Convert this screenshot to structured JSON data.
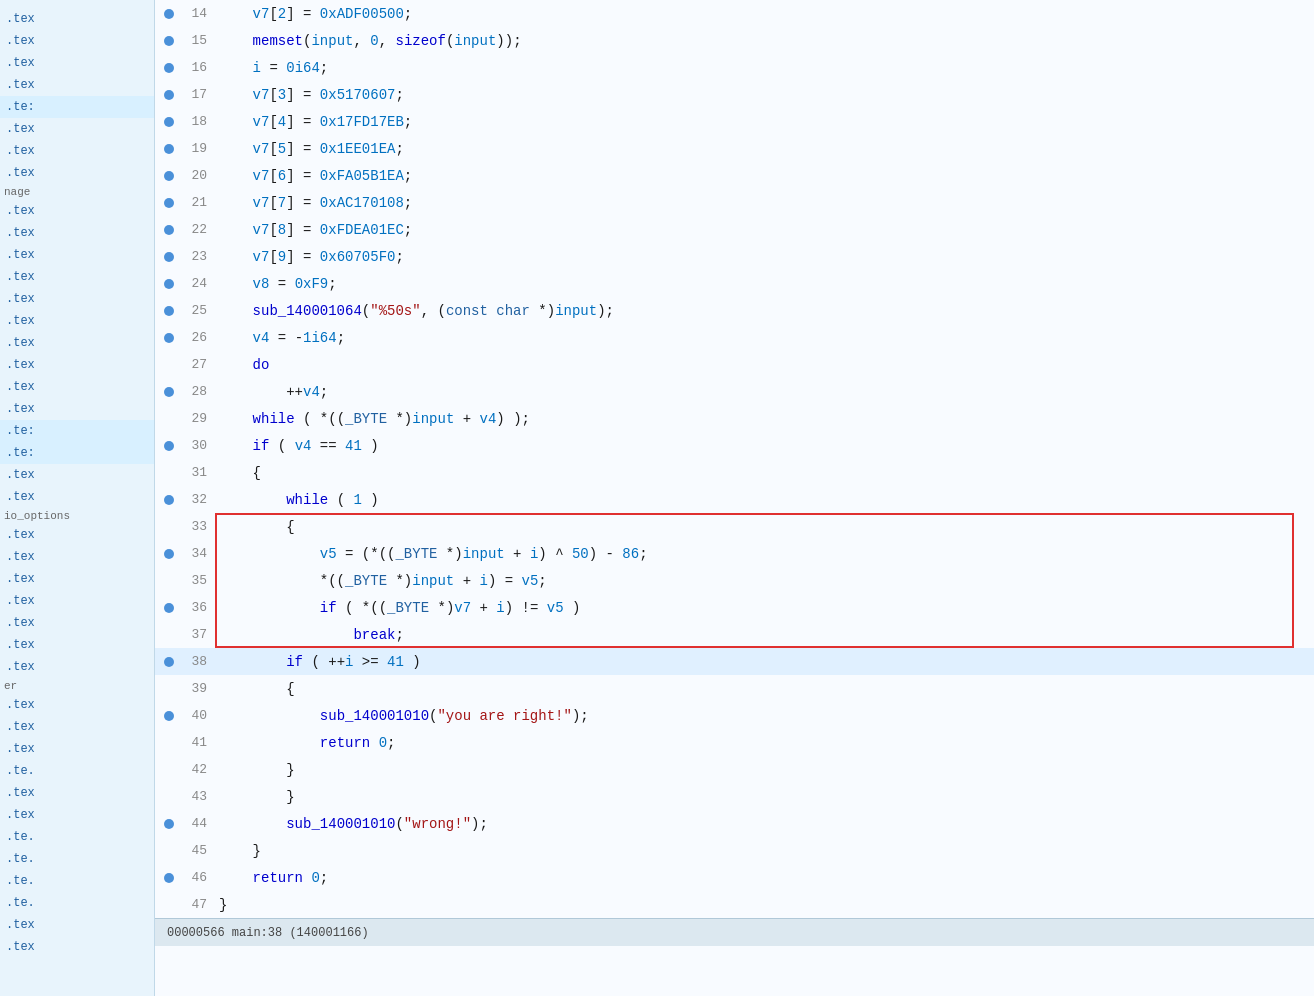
{
  "sidebar": {
    "items": [
      {
        "label": ".tex",
        "type": "normal"
      },
      {
        "label": ".tex",
        "type": "normal"
      },
      {
        "label": ".tex",
        "type": "normal"
      },
      {
        "label": ".tex",
        "type": "normal"
      },
      {
        "label": ".te:",
        "type": "light-blue"
      },
      {
        "label": ".tex",
        "type": "normal"
      },
      {
        "label": ".tex",
        "type": "normal"
      },
      {
        "label": ".tex",
        "type": "normal"
      },
      {
        "label": ".tex",
        "type": "normal"
      },
      {
        "label": ".tex",
        "type": "normal"
      },
      {
        "label": ".tex",
        "type": "normal"
      },
      {
        "label": ".tex",
        "type": "normal"
      },
      {
        "label": ".tex",
        "type": "normal"
      },
      {
        "label": ".te:",
        "type": "light-blue"
      },
      {
        "label": ".te:",
        "type": "light-blue"
      },
      {
        "label": ".tex",
        "type": "normal"
      },
      {
        "label": ".tex",
        "type": "normal"
      },
      {
        "label": ".tex",
        "type": "normal"
      },
      {
        "label": ".tex",
        "type": "normal"
      },
      {
        "label": ".tex",
        "type": "normal"
      },
      {
        "label": ".tex",
        "type": "normal"
      },
      {
        "label": ".tex",
        "type": "normal"
      },
      {
        "label": ".tex",
        "type": "normal"
      },
      {
        "label": ".tex",
        "type": "normal"
      },
      {
        "label": ".tex",
        "type": "normal"
      },
      {
        "label": ".te.",
        "type": "normal"
      },
      {
        "label": ".tex",
        "type": "normal"
      },
      {
        "label": ".tex",
        "type": "normal"
      },
      {
        "label": ".te.",
        "type": "normal"
      },
      {
        "label": ".te.",
        "type": "normal"
      },
      {
        "label": ".te.",
        "type": "normal"
      },
      {
        "label": ".te.",
        "type": "normal"
      },
      {
        "label": ".tex",
        "type": "normal"
      },
      {
        "label": ".tex",
        "type": "normal"
      }
    ],
    "labels": [
      {
        "label": "nage",
        "pos": 8
      },
      {
        "label": "io_options",
        "pos": 21
      },
      {
        "label": "er",
        "pos": 28
      }
    ]
  },
  "code": {
    "lines": [
      {
        "num": 14,
        "dot": true,
        "content": "v7[2] = 0xADF00500;",
        "indent": 2
      },
      {
        "num": 15,
        "dot": true,
        "content": "memset(input, 0, sizeof(input));",
        "indent": 2
      },
      {
        "num": 16,
        "dot": true,
        "content": "i = 0i64;",
        "indent": 2
      },
      {
        "num": 17,
        "dot": true,
        "content": "v7[3] = 0x5170607;",
        "indent": 2
      },
      {
        "num": 18,
        "dot": true,
        "content": "v7[4] = 0x17FD17EB;",
        "indent": 2
      },
      {
        "num": 19,
        "dot": true,
        "content": "v7[5] = 0x1EE01EA;",
        "indent": 2
      },
      {
        "num": 20,
        "dot": true,
        "content": "v7[6] = 0xFA05B1EA;",
        "indent": 2
      },
      {
        "num": 21,
        "dot": true,
        "content": "v7[7] = 0xAC170108;",
        "indent": 2
      },
      {
        "num": 22,
        "dot": true,
        "content": "v7[8] = 0xFDEA01EC;",
        "indent": 2
      },
      {
        "num": 23,
        "dot": true,
        "content": "v7[9] = 0x60705F0;",
        "indent": 2
      },
      {
        "num": 24,
        "dot": true,
        "content": "v8 = 0xF9;",
        "indent": 2
      },
      {
        "num": 25,
        "dot": true,
        "content": "sub_140001064(\"%50s\", (const char *)input);",
        "indent": 2
      },
      {
        "num": 26,
        "dot": true,
        "content": "v4 = -1i64;",
        "indent": 2
      },
      {
        "num": 27,
        "dot": false,
        "content": "do",
        "indent": 2
      },
      {
        "num": 28,
        "dot": true,
        "content": "++v4;",
        "indent": 4
      },
      {
        "num": 29,
        "dot": false,
        "content": "while ( *((_BYTE *)input + v4) );",
        "indent": 2
      },
      {
        "num": 30,
        "dot": true,
        "content": "if ( v4 == 41 )",
        "indent": 2
      },
      {
        "num": 31,
        "dot": false,
        "content": "{",
        "indent": 2
      },
      {
        "num": 32,
        "dot": true,
        "content": "while ( 1 )",
        "indent": 4
      },
      {
        "num": 33,
        "dot": false,
        "content": "{",
        "indent": 4,
        "red_start": true
      },
      {
        "num": 34,
        "dot": true,
        "content": "v5 = (*((_BYTE *)input + i) ^ 50) - 86;",
        "indent": 6,
        "in_red": true
      },
      {
        "num": 35,
        "dot": false,
        "content": "*((_BYTE *)input + i) = v5;",
        "indent": 6,
        "in_red": true
      },
      {
        "num": 36,
        "dot": true,
        "content": "if ( *((_BYTE *)v7 + i) != v5 )",
        "indent": 6,
        "in_red": true
      },
      {
        "num": 37,
        "dot": false,
        "content": "break;",
        "indent": 8,
        "red_end": true
      },
      {
        "num": 38,
        "dot": true,
        "content": "if ( ++i >= 41 )",
        "indent": 4,
        "highlighted": true
      },
      {
        "num": 39,
        "dot": false,
        "content": "{",
        "indent": 4
      },
      {
        "num": 40,
        "dot": true,
        "content": "sub_140001010(\"you are right!\");",
        "indent": 6
      },
      {
        "num": 41,
        "dot": false,
        "content": "return 0;",
        "indent": 6
      },
      {
        "num": 42,
        "dot": false,
        "content": "}",
        "indent": 4
      },
      {
        "num": 43,
        "dot": false,
        "content": "}",
        "indent": 4
      },
      {
        "num": 44,
        "dot": true,
        "content": "sub_140001010(\"wrong!\");",
        "indent": 4
      },
      {
        "num": 45,
        "dot": false,
        "content": "}",
        "indent": 2
      },
      {
        "num": 46,
        "dot": true,
        "content": "return 0;",
        "indent": 2
      },
      {
        "num": 47,
        "dot": false,
        "content": "}",
        "indent": 0
      }
    ]
  },
  "statusbar": {
    "text": "00000566 main:38 (140001166)"
  }
}
